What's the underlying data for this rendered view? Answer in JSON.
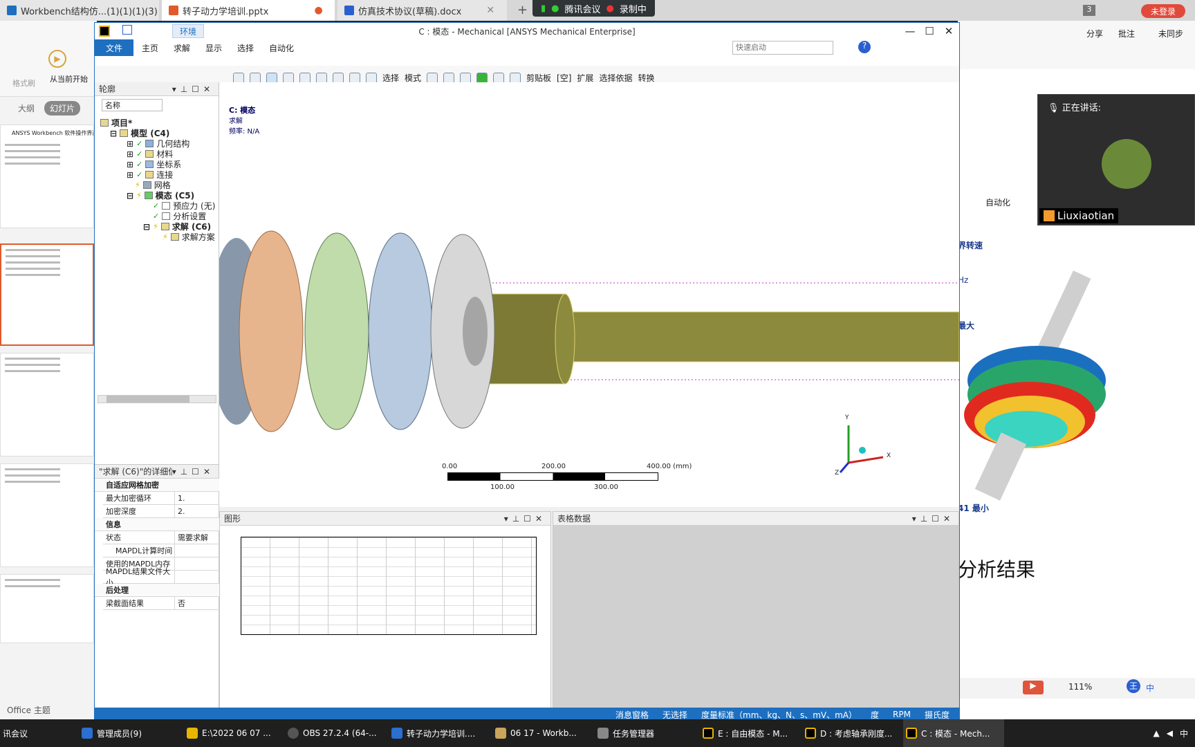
{
  "browser_tabs": [
    {
      "label": "Workbench结构仿...(1)(1)(1)(3)"
    },
    {
      "label": "转子动力学培训.pptx"
    },
    {
      "label": "仿真技术协议(草稿).docx"
    }
  ],
  "meeting": {
    "app": "腾讯会议",
    "recording": "录制中",
    "login": "未登录",
    "count": "3"
  },
  "ppt": {
    "left_tabs": [
      "大纲",
      "幻灯片"
    ],
    "slide1_title": "ANSYS Workbench 软件操作界面",
    "start_from_current": "从当前开始",
    "format": "格式刷",
    "theme": "Office 主题",
    "right_menu": [
      "分享",
      "批注",
      "未同步"
    ],
    "right_tab": "自动化",
    "right_texts": [
      "界转速",
      "Hz",
      "最大",
      "41 最小"
    ],
    "right_title": "分析结果",
    "zoom": "111%"
  },
  "window": {
    "title": "C : 模态 - Mechanical [ANSYS Mechanical Enterprise]",
    "context_tab": "环境",
    "tabs": [
      "文件",
      "主页",
      "求解",
      "显示",
      "选择",
      "自动化"
    ],
    "quick_launch_placeholder": "快速启动",
    "toolbar_labels": [
      "选择",
      "模式",
      "剪贴板",
      "[空]",
      "扩展",
      "选择依据",
      "转换"
    ]
  },
  "outline": {
    "title": "轮廓",
    "filter": "名称",
    "tree": [
      {
        "label": "项目*",
        "level": 0
      },
      {
        "label": "模型 (C4)",
        "level": 1,
        "bold": true
      },
      {
        "label": "几何结构",
        "level": 2
      },
      {
        "label": "材料",
        "level": 2
      },
      {
        "label": "坐标系",
        "level": 2
      },
      {
        "label": "连接",
        "level": 2
      },
      {
        "label": "网格",
        "level": 2
      },
      {
        "label": "模态 (C5)",
        "level": 2,
        "bold": true
      },
      {
        "label": "预应力 (无)",
        "level": 3
      },
      {
        "label": "分析设置",
        "level": 3
      },
      {
        "label": "求解 (C6)",
        "level": 3,
        "bold": true
      },
      {
        "label": "求解方案",
        "level": 4
      }
    ]
  },
  "details": {
    "title": "\"求解 (C6)\"的详细信息",
    "groups": [
      {
        "name": "自适应网格加密",
        "rows": [
          [
            "最大加密循环",
            "1."
          ],
          [
            "加密深度",
            "2."
          ]
        ]
      },
      {
        "name": "信息",
        "rows": [
          [
            "状态",
            "需要求解"
          ],
          [
            "MAPDL计算时间",
            ""
          ],
          [
            "使用的MAPDL内存",
            ""
          ],
          [
            "MAPDL结果文件大小",
            ""
          ]
        ]
      },
      {
        "name": "后处理",
        "rows": [
          [
            "梁截面结果",
            "否"
          ]
        ]
      }
    ]
  },
  "viewport": {
    "heading": "C: 模态",
    "sub1": "求解",
    "sub2": "频率: N/A",
    "scale_top": [
      "0.00",
      "200.00",
      "400.00 (mm)"
    ],
    "scale_bottom": [
      "100.00",
      "300.00"
    ],
    "axes": [
      "Y",
      "X",
      "Z"
    ]
  },
  "bottom_panels": {
    "graph": "图形",
    "table": "表格数据"
  },
  "status": {
    "messages": "消息窗格",
    "selection": "无选择",
    "units": "度量标准（mm、kg、N、s、mV、mA）",
    "deg": "度",
    "rpm": "RPM",
    "temp": "摄氏度"
  },
  "speaker": {
    "label": "正在讲话:",
    "name": "Liuxiaotian"
  },
  "taskbar": [
    {
      "label": "讯会议"
    },
    {
      "label": "管理成员(9)"
    },
    {
      "label": "E:\\2022 06 07 ..."
    },
    {
      "label": "OBS 27.2.4 (64-..."
    },
    {
      "label": "转子动力学培训...."
    },
    {
      "label": "06 17 - Workb..."
    },
    {
      "label": "任务管理器"
    },
    {
      "label": "E : 自由模态 - M..."
    },
    {
      "label": "D : 考虑轴承刚度..."
    },
    {
      "label": "C : 模态 - Mech..."
    }
  ],
  "tray": {
    "ime": "中",
    "wang": "王"
  }
}
